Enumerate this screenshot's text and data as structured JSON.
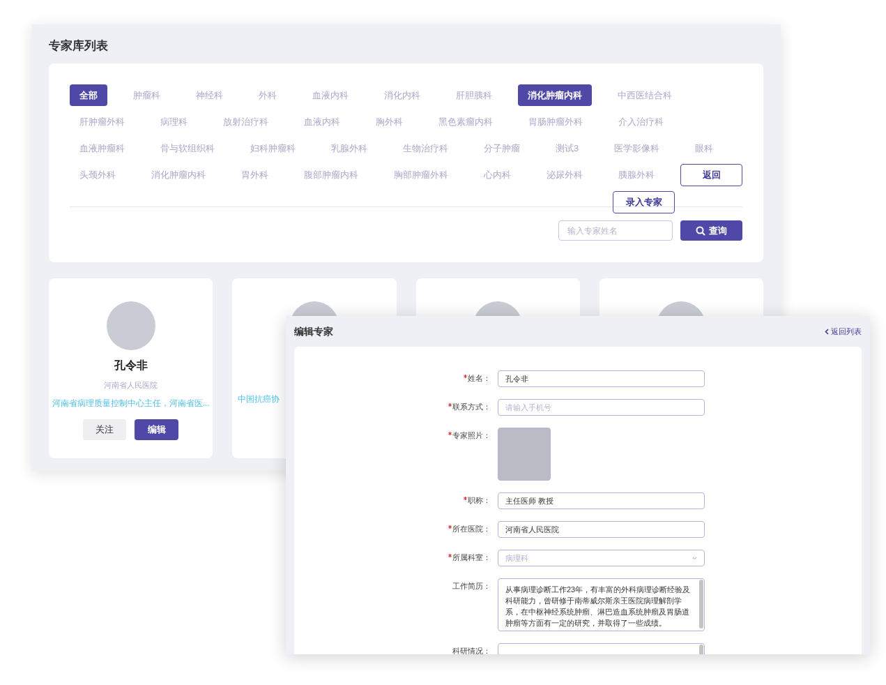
{
  "expert_list": {
    "title": "专家库列表",
    "departments": [
      {
        "label": "全部",
        "selected": true
      },
      {
        "label": "肿瘤科",
        "selected": false
      },
      {
        "label": "神经科",
        "selected": false
      },
      {
        "label": "外科",
        "selected": false
      },
      {
        "label": "血液内科",
        "selected": false
      },
      {
        "label": "消化内科",
        "selected": false
      },
      {
        "label": "肝胆胰科",
        "selected": false
      },
      {
        "label": "消化肿瘤内科",
        "selected": true
      },
      {
        "label": "中西医结合科",
        "selected": false
      },
      {
        "label": "肝肿瘤外科",
        "selected": false
      },
      {
        "label": "病理科",
        "selected": false
      },
      {
        "label": "放射治疗科",
        "selected": false
      },
      {
        "label": "血液内科",
        "selected": false
      },
      {
        "label": "胸外科",
        "selected": false
      },
      {
        "label": "黑色素瘤内科",
        "selected": false
      },
      {
        "label": "胃肠肿瘤外科",
        "selected": false
      },
      {
        "label": "介入治疗科",
        "selected": false
      },
      {
        "label": "血液肿瘤科",
        "selected": false
      },
      {
        "label": "骨与软组织科",
        "selected": false
      },
      {
        "label": "妇科肿瘤科",
        "selected": false
      },
      {
        "label": "乳腺外科",
        "selected": false
      },
      {
        "label": "生物治疗科",
        "selected": false
      },
      {
        "label": "分子肿瘤",
        "selected": false
      },
      {
        "label": "测试3",
        "selected": false
      },
      {
        "label": "医学影像科",
        "selected": false
      },
      {
        "label": "眼科",
        "selected": false
      },
      {
        "label": "头颈外科",
        "selected": false
      },
      {
        "label": "消化肿瘤内科",
        "selected": false
      },
      {
        "label": "胃外科",
        "selected": false
      },
      {
        "label": "腹部肿瘤内科",
        "selected": false
      },
      {
        "label": "胸部肿瘤外科",
        "selected": false
      },
      {
        "label": "心内科",
        "selected": false
      },
      {
        "label": "泌尿外科",
        "selected": false
      },
      {
        "label": "胰腺外科",
        "selected": false
      }
    ],
    "back_button": "返回",
    "add_button": "录入专家",
    "search": {
      "placeholder": "输入专家姓名",
      "button": "查询"
    },
    "cards": [
      {
        "kind": "full",
        "name": "孔令非",
        "hospital": "河南省人民医院",
        "description": "河南省病理质量控制中心主任，河南省医...",
        "follow_button": "关注",
        "edit_button": "编辑"
      },
      {
        "kind": "covered",
        "description": "中国抗癌协"
      },
      {
        "kind": "covered"
      },
      {
        "kind": "covered"
      }
    ]
  },
  "edit_expert": {
    "title": "编辑专家",
    "back_link": "返回列表",
    "fields": [
      {
        "kind": "text",
        "label": "姓名：",
        "required": true,
        "value": "孔令非"
      },
      {
        "kind": "text",
        "label": "联系方式：",
        "required": true,
        "placeholder": "请输入手机号"
      },
      {
        "kind": "photo",
        "label": "专家照片：",
        "required": true
      },
      {
        "kind": "text",
        "label": "职称：",
        "required": true,
        "value": "主任医师 教授"
      },
      {
        "kind": "text",
        "label": "所在医院：",
        "required": true,
        "value": "河南省人民医院"
      },
      {
        "kind": "select",
        "label": "所属科室：",
        "required": true,
        "value": "病理科"
      },
      {
        "kind": "textarea",
        "label": "工作简历：",
        "required": false,
        "value": "从事病理诊断工作23年，有丰富的外科病理诊断经验及科研能力，曾研修于南蒂威尔斯亲王医院病理解剖学系，在中枢神经系统肿瘤、淋巴造血系统肿瘤及胃肠道肿瘤等方面有一定的研究，并取得了一些成绩。"
      },
      {
        "kind": "textarea",
        "label": "科研情况：",
        "required": false
      }
    ]
  }
}
